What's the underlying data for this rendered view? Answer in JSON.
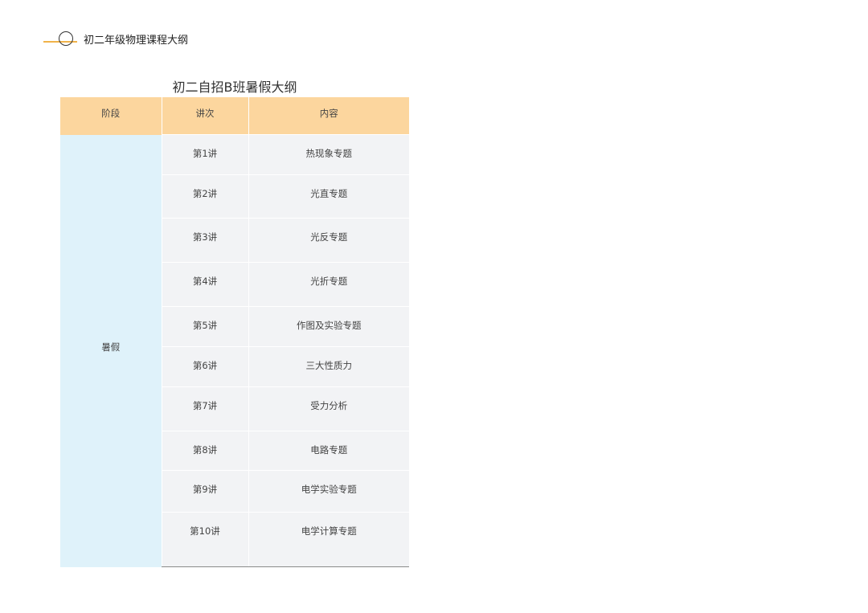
{
  "header": {
    "title": "初二年级物理课程大纲",
    "accent_color": "#f1b34a"
  },
  "table": {
    "title": "初二自招B班暑假大纲",
    "columns": [
      "阶段",
      "讲次",
      "内容"
    ],
    "header_color": "#fcd69e",
    "stage_color": "#dff2fa",
    "stage": "暑假",
    "rows": [
      {
        "lecture": "第1讲",
        "content": "热现象专题"
      },
      {
        "lecture": "第2讲",
        "content": "光直专题"
      },
      {
        "lecture": "第3讲",
        "content": "光反专题"
      },
      {
        "lecture": "第4讲",
        "content": "光折专题"
      },
      {
        "lecture": "第5讲",
        "content": "作图及实验专题"
      },
      {
        "lecture": "第6讲",
        "content": "三大性质力"
      },
      {
        "lecture": "第7讲",
        "content": "受力分析"
      },
      {
        "lecture": "第8讲",
        "content": "电路专题"
      },
      {
        "lecture": "第9讲",
        "content": "电学实验专题"
      },
      {
        "lecture": "第10讲",
        "content": "电学计算专题"
      }
    ]
  }
}
